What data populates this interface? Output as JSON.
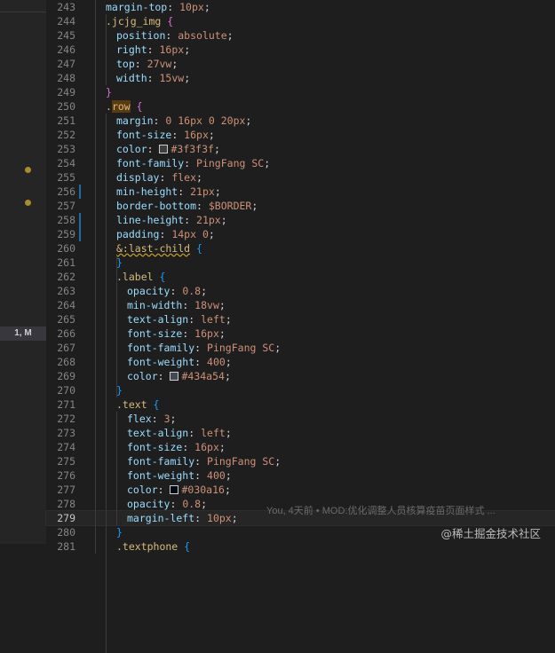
{
  "colors": {
    "background": "#1e1e1e",
    "sidebar": "#252526",
    "modified_marker": "#1b6ca8",
    "dot": "#a88c2d"
  },
  "sidebar": {
    "badge": "1, M"
  },
  "editor": {
    "active_line": 279,
    "lines": [
      {
        "n": 243,
        "t": "margin-top: 10px;"
      },
      {
        "n": 244,
        "t": ".jcjg_img {"
      },
      {
        "n": 245,
        "t": "position: absolute;"
      },
      {
        "n": 246,
        "t": "right: 16px;"
      },
      {
        "n": 247,
        "t": "top: 27vw;"
      },
      {
        "n": 248,
        "t": "width: 15vw;"
      },
      {
        "n": 249,
        "t": "}"
      },
      {
        "n": 250,
        "t": ".row {"
      },
      {
        "n": 251,
        "t": "margin: 0 16px 0 20px;"
      },
      {
        "n": 252,
        "t": "font-size: 16px;"
      },
      {
        "n": 253,
        "t": "color: #3f3f3f;"
      },
      {
        "n": 254,
        "t": "font-family: PingFang SC;"
      },
      {
        "n": 255,
        "t": "display: flex;"
      },
      {
        "n": 256,
        "t": "min-height: 21px;"
      },
      {
        "n": 257,
        "t": "border-bottom: $BORDER;"
      },
      {
        "n": 258,
        "t": "line-height: 21px;"
      },
      {
        "n": 259,
        "t": "padding: 14px 0;"
      },
      {
        "n": 260,
        "t": "&:last-child {"
      },
      {
        "n": 261,
        "t": "}"
      },
      {
        "n": 262,
        "t": ".label {"
      },
      {
        "n": 263,
        "t": "opacity: 0.8;"
      },
      {
        "n": 264,
        "t": "min-width: 18vw;"
      },
      {
        "n": 265,
        "t": "text-align: left;"
      },
      {
        "n": 266,
        "t": "font-size: 16px;"
      },
      {
        "n": 267,
        "t": "font-family: PingFang SC;"
      },
      {
        "n": 268,
        "t": "font-weight: 400;"
      },
      {
        "n": 269,
        "t": "color: #434a54;"
      },
      {
        "n": 270,
        "t": "}"
      },
      {
        "n": 271,
        "t": ".text {"
      },
      {
        "n": 272,
        "t": "flex: 3;"
      },
      {
        "n": 273,
        "t": "text-align: left;"
      },
      {
        "n": 274,
        "t": "font-size: 16px;"
      },
      {
        "n": 275,
        "t": "font-family: PingFang SC;"
      },
      {
        "n": 276,
        "t": "font-weight: 400;"
      },
      {
        "n": 277,
        "t": "color: #030a16;"
      },
      {
        "n": 278,
        "t": "opacity: 0.8;"
      },
      {
        "n": 279,
        "t": "margin-left: 10px;"
      },
      {
        "n": 280,
        "t": "}"
      },
      {
        "n": 281,
        "t": ".textphone {"
      }
    ]
  },
  "blame": "You, 4天前 • MOD:优化调整人员核算疫苗页面样式 ...",
  "watermark": "@稀土掘金技术社区"
}
